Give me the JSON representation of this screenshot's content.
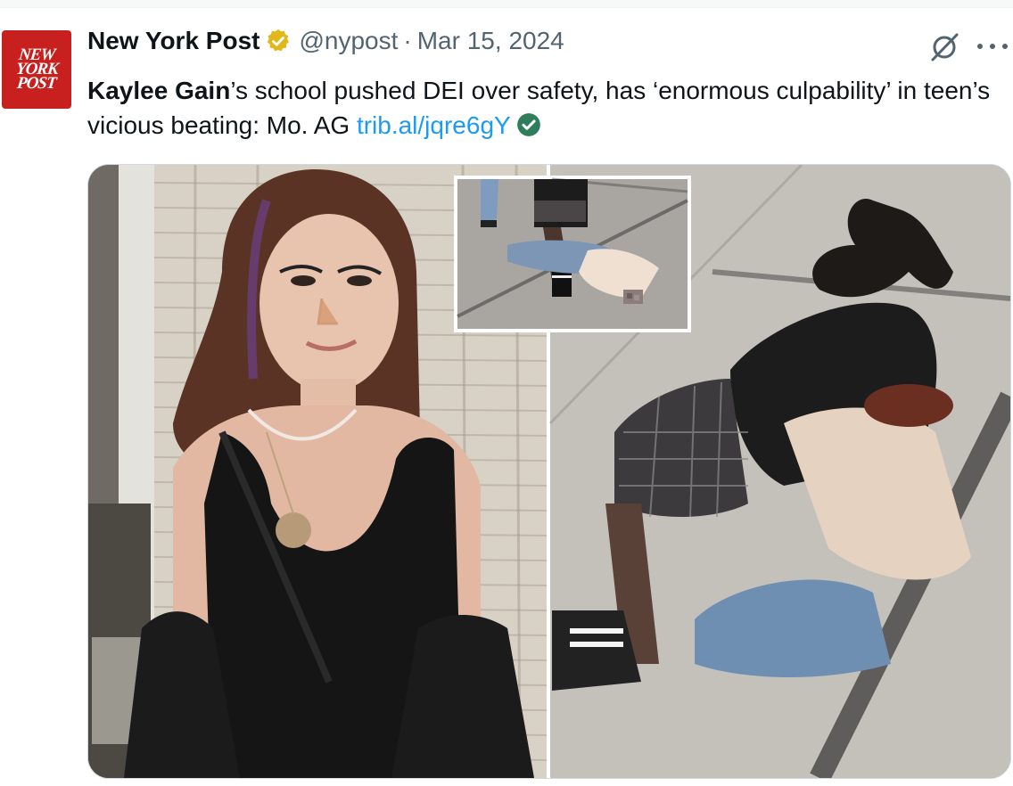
{
  "tweet": {
    "author": {
      "name": "New York Post",
      "handle": "@nypost",
      "avatar_lines": [
        "NEW",
        "YORK",
        "POST"
      ],
      "verified_color": "#e2b719"
    },
    "separator": "·",
    "date": "Mar 15, 2024",
    "text": {
      "bold_name": "Kaylee Gain",
      "body": "’s school pushed DEI over safety, has ‘enormous culpability’ in teen’s vicious beating: Mo. AG ",
      "link": "trib.al/jqre6gY"
    },
    "icons": {
      "grok": "grok-icon",
      "more": "more-icon",
      "link_check": "check-circle-icon",
      "verified": "verified-badge-icon"
    },
    "colors": {
      "link": "#1d9bf0",
      "avatar_bg": "#c8201f",
      "check_green": "#2e7d5b"
    }
  }
}
